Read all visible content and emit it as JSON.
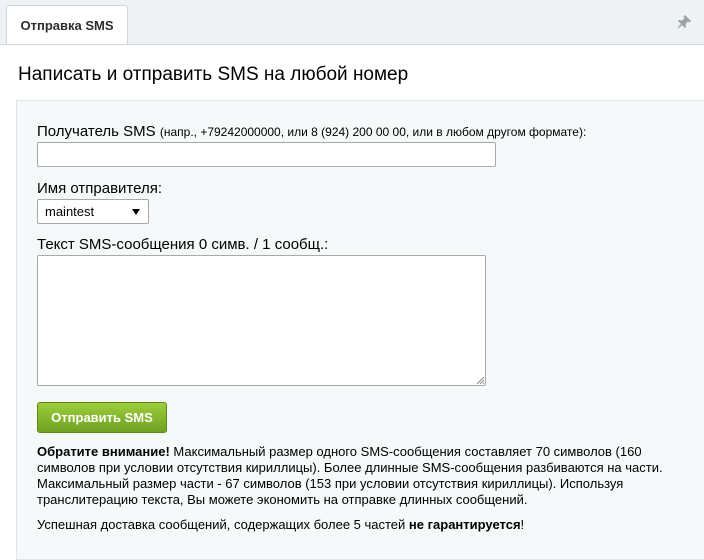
{
  "tab": {
    "label": "Отправка SMS"
  },
  "page": {
    "title": "Написать и отправить SMS на любой номер"
  },
  "form": {
    "recipient_label": "Получатель SMS",
    "recipient_hint": "(напр., +79242000000, или 8 (924) 200 00 00, или в любом другом формате):",
    "recipient_value": "",
    "sender_label": "Имя отправителя:",
    "sender_selected": "maintest",
    "text_label": "Текст SMS-сообщения 0 симв. / 1 сообщ.:",
    "text_value": "",
    "send_label": "Отправить SMS"
  },
  "notice": {
    "bold_intro": "Обратите внимание!",
    "body": " Максимальный размер одного SMS-сообщения составляет 70 символов (160 символов при условии отсутствия кириллицы). Более длинные SMS-сообщения разбиваются на части. Максимальный размер части - 67 символов (153 при условии отсутствия кириллицы). Используя транслитерацию текста, Вы можете экономить на отправке длинных сообщений.",
    "delivery_text": "Успешная доставка сообщений, содержащих более 5 частей ",
    "delivery_bold": "не гарантируется",
    "delivery_end": "!"
  },
  "icons": {
    "pin": "pin-icon",
    "resize": "resize-grip-icon",
    "dropdown": "chevron-down-icon"
  },
  "colors": {
    "button": "#7db12a",
    "topbar": "#eef2f4",
    "panel": "#f5f9f9"
  }
}
